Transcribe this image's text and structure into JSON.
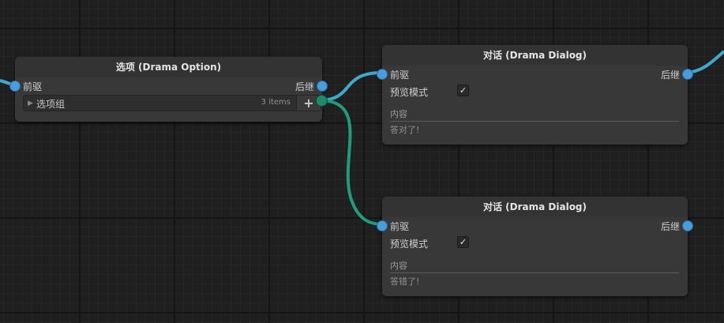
{
  "colors": {
    "port_blue": "#4a9ddd",
    "port_option": "#1f8a6a",
    "wire_blue": "#3fa9c9",
    "wire_green": "#1f9c7a"
  },
  "option_node": {
    "title": "选项 (Drama Option)",
    "input_label": "前驱",
    "output_label": "后继",
    "group_label": "选项组",
    "group_count": "3 items",
    "add_icon": "plus-icon",
    "add_symbol": "+"
  },
  "dialog_nodes": [
    {
      "title": "对话 (Drama Dialog)",
      "input_label": "前驱",
      "output_label": "后继",
      "preview_label": "预览模式",
      "preview_checked": "✓",
      "content_label": "内容",
      "content_text": "答对了!"
    },
    {
      "title": "对话 (Drama Dialog)",
      "input_label": "前驱",
      "output_label": "后继",
      "preview_label": "预览模式",
      "preview_checked": "✓",
      "content_label": "内容",
      "content_text": "答错了!"
    }
  ]
}
